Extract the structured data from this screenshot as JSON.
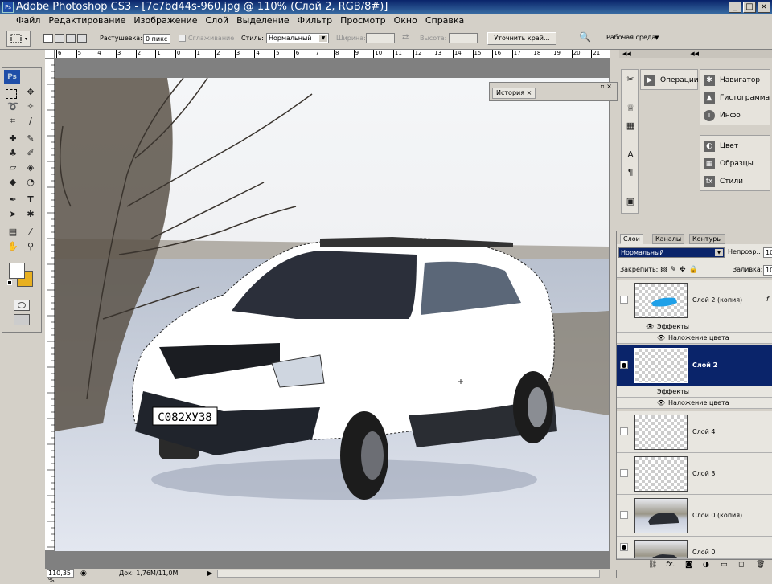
{
  "window": {
    "title": "Adobe Photoshop CS3 - [7c7bd44s-960.jpg @ 110% (Слой 2, RGB/8#)]",
    "app_icon": "Ps"
  },
  "menu": [
    "Файл",
    "Редактирование",
    "Изображение",
    "Слой",
    "Выделение",
    "Фильтр",
    "Просмотр",
    "Окно",
    "Справка"
  ],
  "options": {
    "feather_label": "Растушевка:",
    "feather_value": "0 пикс",
    "antialias_label": "Сглаживание",
    "style_label": "Стиль:",
    "style_value": "Нормальный",
    "width_label": "Ширина:",
    "height_label": "Высота:",
    "refine_button": "Уточнить край...",
    "workspace_label": "Рабочая среда"
  },
  "toolbox": {
    "logo": "Ps"
  },
  "ruler": {
    "ticks": [
      "6",
      "5",
      "4",
      "3",
      "2",
      "1",
      "0",
      "1",
      "2",
      "3",
      "4",
      "5",
      "6",
      "7",
      "8",
      "9",
      "10",
      "11",
      "12",
      "13",
      "14",
      "15",
      "16",
      "17",
      "18",
      "19",
      "20",
      "21"
    ]
  },
  "photo": {
    "plate": "С082ХУ38"
  },
  "history": {
    "tab": "История"
  },
  "panels": {
    "group1": [
      {
        "icon": "play-icon",
        "label": "Операции"
      }
    ],
    "group2": [
      {
        "icon": "navigator-icon",
        "label": "Навигатор"
      },
      {
        "icon": "histogram-icon",
        "label": "Гистограмма"
      },
      {
        "icon": "info-icon",
        "label": "Инфо"
      }
    ],
    "group3": [
      {
        "icon": "color-icon",
        "label": "Цвет"
      },
      {
        "icon": "swatches-icon",
        "label": "Образцы"
      },
      {
        "icon": "styles-icon",
        "label": "Стили"
      }
    ]
  },
  "layers_panel": {
    "tabs": [
      "Слои",
      "Каналы",
      "Контуры"
    ],
    "blend_mode": "Нормальный",
    "opacity_label": "Непрозр.:",
    "opacity_value": "10",
    "lock_label": "Закрепить:",
    "fill_label": "Заливка:",
    "fill_value": "10",
    "effects_label": "Эффекты",
    "color_overlay_label": "Наложение цвета",
    "layers": [
      {
        "name": "Слой 2 (копия)",
        "visible": false,
        "selected": false
      },
      {
        "name": "Слой 2",
        "visible": true,
        "selected": true
      },
      {
        "name": "Слой 4",
        "visible": false,
        "selected": false
      },
      {
        "name": "Слой 3",
        "visible": false,
        "selected": false
      },
      {
        "name": "Слой 0 (копия)",
        "visible": false,
        "selected": false
      },
      {
        "name": "Слой 0",
        "visible": true,
        "selected": false
      }
    ]
  },
  "status": {
    "zoom": "110,35 %",
    "doc": "Док: 1,76М/11,0М"
  },
  "colors": {
    "title_bar": "#0a246a",
    "selected_layer": "#0a246a",
    "background_swatch": "#e8b020"
  }
}
